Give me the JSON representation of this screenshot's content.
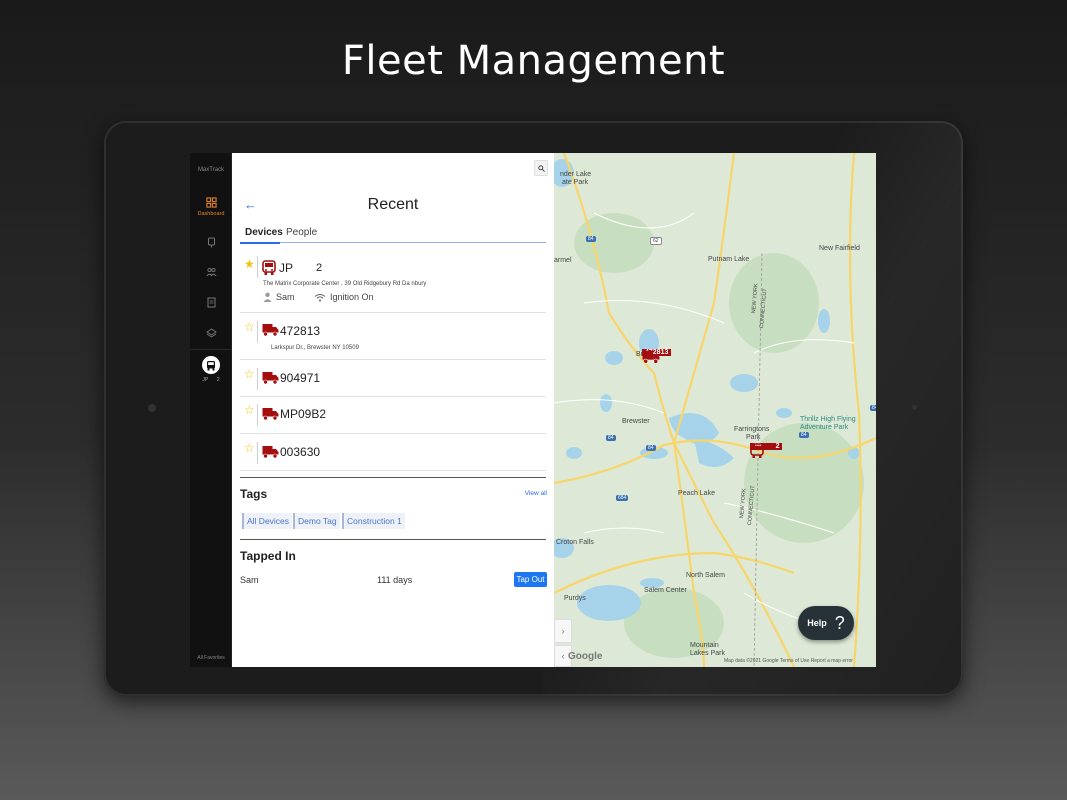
{
  "headline": "Fleet Management",
  "rail": {
    "logo": "MaxTrack",
    "dashboard_label": "Dashboard",
    "bus_tags": [
      "JP",
      "2"
    ],
    "favorites_label": "All Favorites"
  },
  "panel": {
    "title": "Recent",
    "tabs": [
      "Devices",
      "People"
    ],
    "devices": [
      {
        "name": "JP",
        "number": "2",
        "starred": true,
        "icon": "bus-icon",
        "address": "The Matrix Corporate Center ,  39 Old Ridgebury Rd  Da nbury",
        "driver": "Sam",
        "status": "Ignition On"
      },
      {
        "name": "472813",
        "starred": false,
        "icon": "truck-icon",
        "address": "Larkspur Dr.,  Brewster  NY 10509"
      },
      {
        "name": "904971",
        "starred": false,
        "icon": "truck-icon"
      },
      {
        "name": "MP09B2",
        "starred": false,
        "icon": "truck-icon"
      },
      {
        "name": "003630",
        "starred": false,
        "icon": "truck-icon"
      }
    ],
    "tags_title": "Tags",
    "view_all": "View all",
    "tags": [
      "All Devices",
      "Demo Tag",
      "Construction 1"
    ],
    "tapped_title": "Tapped In",
    "tapped": {
      "name": "Sam",
      "duration": "111 days",
      "action": "Tap Out"
    }
  },
  "map": {
    "labels": [
      "nder Lake",
      "ate Park",
      "armel",
      "Putnam Lake",
      "New Fairfield",
      "NEW YORK",
      "CONNECTICUT",
      "Brew",
      "ll",
      "Brewster",
      "Thrillz High Flying",
      "Adventure Park",
      "Farringtons",
      "Park",
      "Peach Lake",
      "NEW YORK",
      "CONNECTICUT",
      "Croton Falls",
      "North Salem",
      "Salem Center",
      "Purdys",
      "Mountain",
      "Lakes Park"
    ],
    "markers": [
      {
        "label": "472813"
      },
      {
        "label_left": "JP",
        "label_right": "2"
      }
    ],
    "help_label": "Help",
    "help_icon": "?",
    "google": "Google",
    "footer": "Map data ©2021 Google    Terms of Use    Report a map error",
    "colors": {
      "water": "#a6d3ea",
      "land": "#dde9d6",
      "road": "#f7d56a",
      "marker": "#a40e0e"
    }
  },
  "colors": {
    "accent": "#2d6be0",
    "tap_out": "#1d77f0",
    "star": "#f1c40f",
    "dashboard": "#e0822b"
  }
}
